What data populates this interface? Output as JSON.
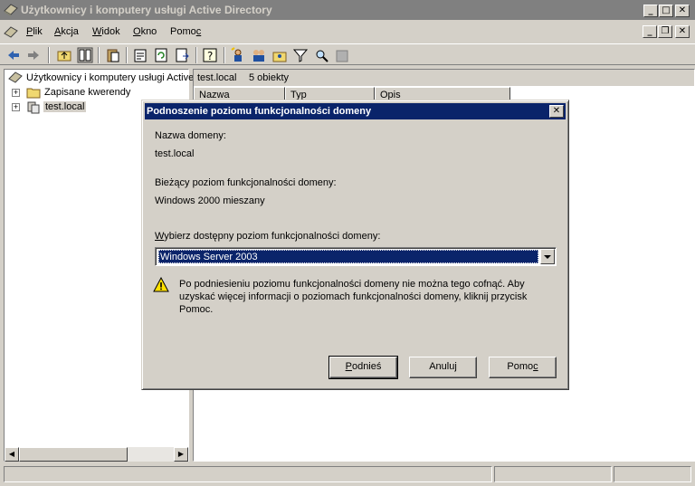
{
  "window": {
    "title": "Użytkownicy i komputery usługi Active Directory"
  },
  "menu": {
    "items": [
      {
        "label": "Plik",
        "accel": "P",
        "rest": "lik"
      },
      {
        "label": "Akcja",
        "accel": "A",
        "rest": "kcja"
      },
      {
        "label": "Widok",
        "accel": "W",
        "rest": "idok"
      },
      {
        "label": "Okno",
        "accel": "O",
        "rest": "kno"
      },
      {
        "label": "Pomoc",
        "accel": "c",
        "pre": "Pomo"
      }
    ]
  },
  "tree": {
    "root": "Użytkownicy i komputery usługi Active Directory",
    "items": [
      "Zapisane kwerendy",
      "test.local"
    ]
  },
  "right": {
    "path": "test.local",
    "count": "5 obiekty",
    "columns": [
      "Nazwa",
      "Typ",
      "Opis"
    ]
  },
  "dialog": {
    "title": "Podnoszenie poziomu funkcjonalności domeny",
    "domain_label": "Nazwa domeny:",
    "domain_value": "test.local",
    "current_label": "Bieżący poziom funkcjonalności domeny:",
    "current_value": "Windows 2000 mieszany",
    "select_label_accel": "W",
    "select_label_rest": "ybierz dostępny poziom funkcjonalności domeny:",
    "select_value": "Windows Server 2003",
    "warning": "Po podniesieniu poziomu funkcjonalności domeny nie można tego cofnąć. Aby uzyskać więcej informacji o poziomach funkcjonalności domeny, kliknij przycisk Pomoc.",
    "buttons": {
      "raise_accel": "P",
      "raise_rest": "odnieś",
      "cancel": "Anuluj",
      "help_pre": "Pomo",
      "help_accel": "c"
    }
  },
  "colors": {
    "active_title": "#0a246a",
    "inactive_title": "#808080",
    "face": "#d4d0c8"
  }
}
